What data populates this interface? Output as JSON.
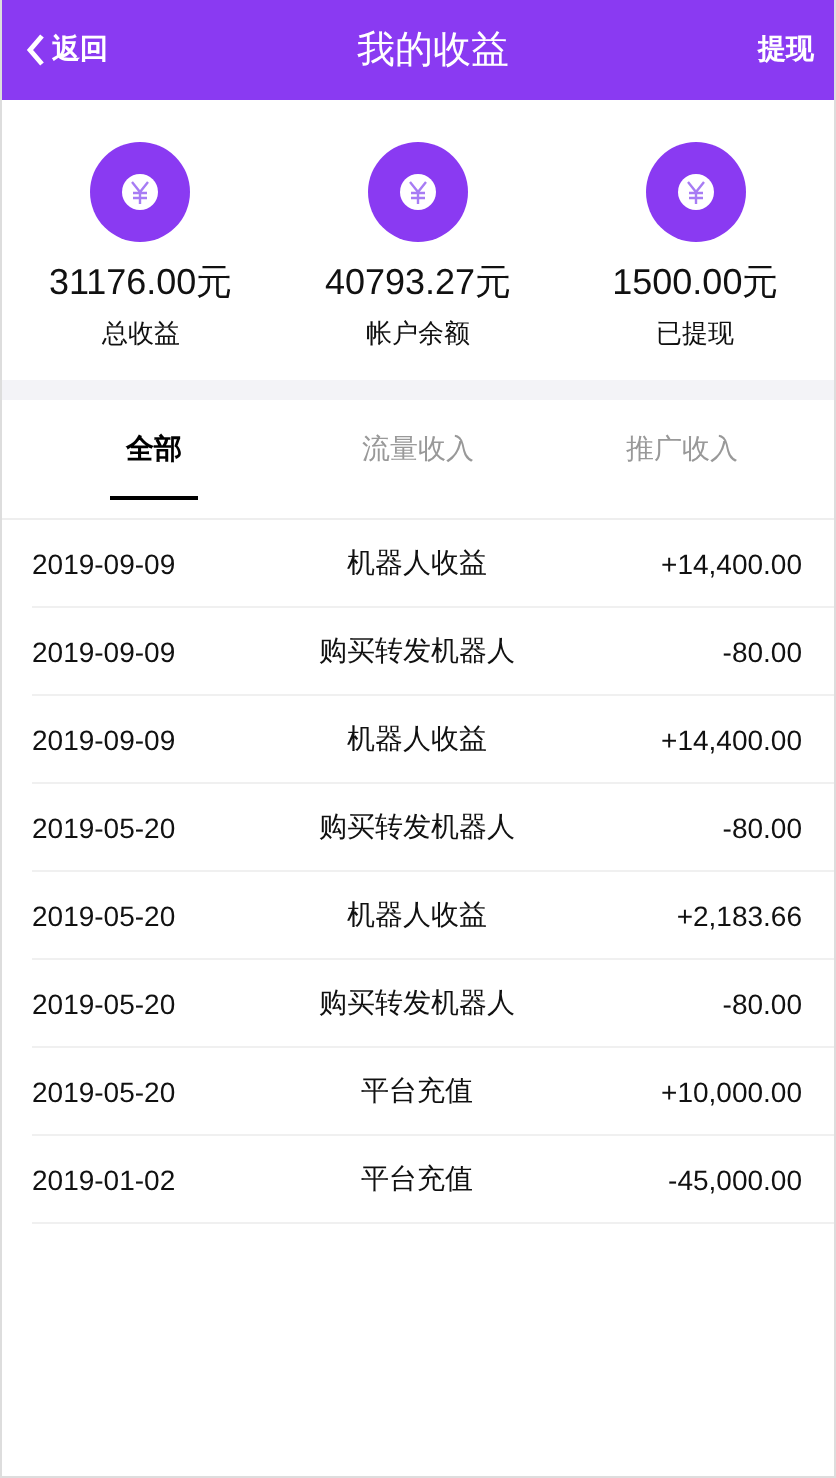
{
  "header": {
    "back": "返回",
    "title": "我的收益",
    "action": "提现"
  },
  "stats": [
    {
      "value": "31176.00元",
      "label": "总收益"
    },
    {
      "value": "40793.27元",
      "label": "帐户余额"
    },
    {
      "value": "1500.00元",
      "label": "已提现"
    }
  ],
  "tabs": [
    {
      "label": "全部",
      "selected": true
    },
    {
      "label": "流量收入",
      "selected": false
    },
    {
      "label": "推广收入",
      "selected": false
    }
  ],
  "records": [
    {
      "date": "2019-09-09",
      "title": "机器人收益",
      "amount": "+14,400.00"
    },
    {
      "date": "2019-09-09",
      "title": "购买转发机器人",
      "amount": "-80.00"
    },
    {
      "date": "2019-09-09",
      "title": "机器人收益",
      "amount": "+14,400.00"
    },
    {
      "date": "2019-05-20",
      "title": "购买转发机器人",
      "amount": "-80.00"
    },
    {
      "date": "2019-05-20",
      "title": "机器人收益",
      "amount": "+2,183.66"
    },
    {
      "date": "2019-05-20",
      "title": "购买转发机器人",
      "amount": "-80.00"
    },
    {
      "date": "2019-05-20",
      "title": "平台充值",
      "amount": "+10,000.00"
    },
    {
      "date": "2019-01-02",
      "title": "平台充值",
      "amount": "-45,000.00"
    }
  ]
}
